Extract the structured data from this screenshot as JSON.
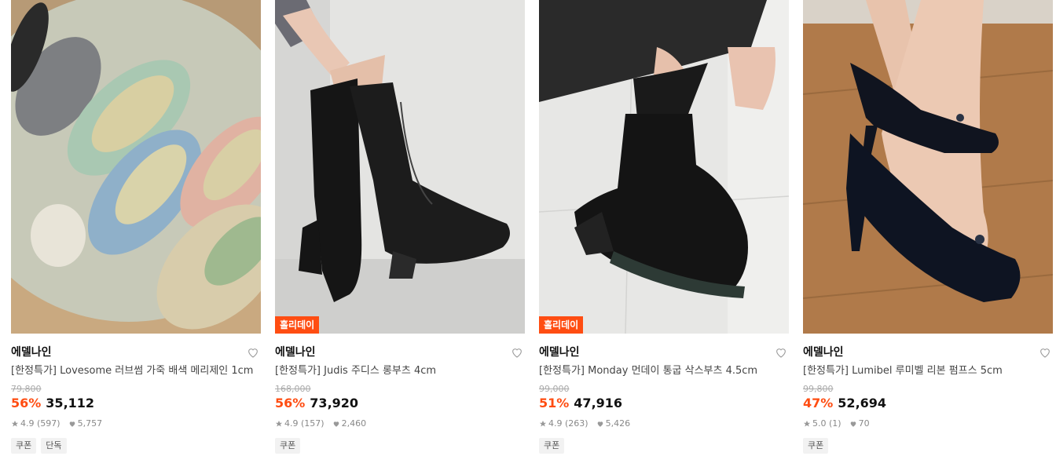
{
  "colors": {
    "accent": "#ff4d12",
    "badge": "#ff4d12"
  },
  "products": [
    {
      "badge": "",
      "brand": "에델나인",
      "name": "[한정특가] Lovesome 러브썸 가죽 배색 메리제인 1cm",
      "original_price": "79,800",
      "discount": "56%",
      "price": "35,112",
      "rating": "4.9 (597)",
      "likes": "5,757",
      "tags": [
        "쿠폰",
        "단독"
      ],
      "image": "mary-jane-flats-photo"
    },
    {
      "badge": "홀리데이",
      "brand": "에델나인",
      "name": "[한정특가] Judis 주디스 롱부츠 4cm",
      "original_price": "168,000",
      "discount": "56%",
      "price": "73,920",
      "rating": "4.9 (157)",
      "likes": "2,460",
      "tags": [
        "쿠폰"
      ],
      "image": "long-boots-photo"
    },
    {
      "badge": "홀리데이",
      "brand": "에델나인",
      "name": "[한정특가] Monday 먼데이 통굽 삭스부츠 4.5cm",
      "original_price": "99,000",
      "discount": "51%",
      "price": "47,916",
      "rating": "4.9 (263)",
      "likes": "5,426",
      "tags": [
        "쿠폰"
      ],
      "image": "sock-boots-photo"
    },
    {
      "badge": "",
      "brand": "에델나인",
      "name": "[한정특가] Lumibel 루미벨 리본 펌프스 5cm",
      "original_price": "99,800",
      "discount": "47%",
      "price": "52,694",
      "rating": "5.0 (1)",
      "likes": "70",
      "tags": [
        "쿠폰"
      ],
      "image": "ribbon-pumps-photo"
    }
  ]
}
